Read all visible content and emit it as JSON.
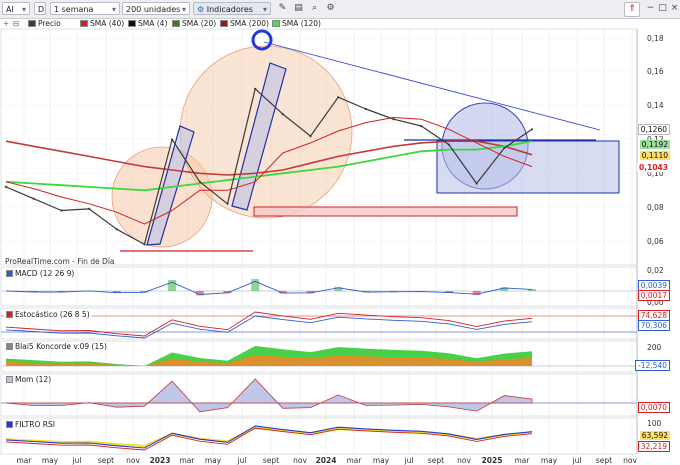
{
  "toolbar": {
    "symbol": "AI",
    "symbol_suffix": "D",
    "period": "1 semana",
    "units": "200 unidades",
    "indicators": "Indicadores",
    "up_icon": "up-arrow-icon",
    "brand_icon": "prorealtime-logo-icon"
  },
  "legend": {
    "items": [
      {
        "label": "Precio",
        "color": "#3a3a3a"
      },
      {
        "label": "SMA (40)",
        "color": "#d42020"
      },
      {
        "label": "SMA (4)",
        "color": "#111111"
      },
      {
        "label": "SMA (20)",
        "color": "#3c7a1e"
      },
      {
        "label": "SMA (200)",
        "color": "#8a1e1e"
      },
      {
        "label": "SMA (120)",
        "color": "#4be04b"
      }
    ]
  },
  "source_label": "ProRealTime.com - Fin de Día",
  "price_axis": {
    "ticks": [
      "0,18",
      "0,16",
      "0,14",
      "0,12",
      "0,10",
      "0,08",
      "0,06"
    ],
    "value_boxes": [
      {
        "label": "0,1260",
        "color": "#ffffff",
        "text": "#111111"
      },
      {
        "label": "0,1192",
        "color": "#9be09b",
        "text": "#111111"
      },
      {
        "label": "0,1110",
        "color": "#ffe066",
        "text": "#111111"
      },
      {
        "label": "0,1043",
        "color": "#ffffff",
        "text": "#d42020"
      }
    ]
  },
  "panes": [
    {
      "label": "MACD (12 26 9)",
      "ticks": [
        "0,02",
        "0,00"
      ],
      "values": [
        "0,0039",
        "0,0017"
      ]
    },
    {
      "label": "Estocástico (26 8 5)",
      "ticks": [],
      "values": [
        "74,628",
        "70,306"
      ]
    },
    {
      "label": "Blai5 Koncorde v.09 (15)",
      "ticks": [
        "200"
      ],
      "values": [
        "-12,540"
      ]
    },
    {
      "label": "Mom (12)",
      "ticks": [],
      "values": [
        "0,0070"
      ]
    },
    {
      "label": "FILTRO RSI",
      "ticks": [
        "100"
      ],
      "values": [
        "63,592",
        "32,219"
      ]
    }
  ],
  "x_axis": {
    "labels": [
      "mar",
      "may",
      "jul",
      "sept",
      "nov",
      "2023",
      "mar",
      "may",
      "jul",
      "sept",
      "nov",
      "2024",
      "mar",
      "may",
      "jul",
      "sept",
      "nov",
      "2025",
      "mar",
      "may",
      "jul",
      "sept",
      "nov"
    ]
  },
  "chart_data": {
    "type": "line",
    "title": "AI",
    "xlabel": "",
    "ylabel": "",
    "ylim": [
      0.045,
      0.185
    ],
    "grid": true,
    "legend": "top-left",
    "x": [
      "2022-01",
      "2022-03",
      "2022-05",
      "2022-07",
      "2022-09",
      "2022-11",
      "2023-01",
      "2023-03",
      "2023-05",
      "2023-07",
      "2023-09",
      "2023-11",
      "2024-01",
      "2024-03",
      "2024-05",
      "2024-07",
      "2024-09",
      "2024-11",
      "2025-01",
      "2025-03"
    ],
    "series": [
      {
        "name": "Precio",
        "values": [
          0.092,
          0.085,
          0.078,
          0.079,
          0.067,
          0.058,
          0.12,
          0.095,
          0.082,
          0.15,
          0.135,
          0.122,
          0.145,
          0.138,
          0.132,
          0.128,
          0.117,
          0.094,
          0.115,
          0.126
        ]
      },
      {
        "name": "SMA (200)",
        "values": [
          0.119,
          0.116,
          0.113,
          0.11,
          0.107,
          0.104,
          0.102,
          0.1,
          0.099,
          0.1,
          0.102,
          0.106,
          0.11,
          0.113,
          0.116,
          0.118,
          0.119,
          0.119,
          0.116,
          0.111
        ]
      },
      {
        "name": "SMA (120)",
        "values": [
          0.095,
          0.094,
          0.093,
          0.092,
          0.091,
          0.09,
          0.092,
          0.094,
          0.096,
          0.098,
          0.1,
          0.102,
          0.104,
          0.107,
          0.11,
          0.113,
          0.114,
          0.114,
          0.116,
          0.119
        ]
      },
      {
        "name": "SMA (40)",
        "values": [
          0.095,
          0.091,
          0.086,
          0.082,
          0.077,
          0.07,
          0.078,
          0.09,
          0.09,
          0.095,
          0.112,
          0.118,
          0.125,
          0.13,
          0.133,
          0.132,
          0.126,
          0.118,
          0.11,
          0.104
        ]
      }
    ]
  }
}
